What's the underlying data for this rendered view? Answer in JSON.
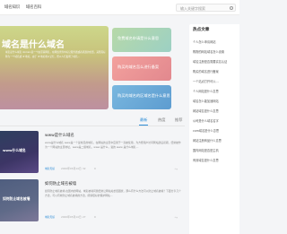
{
  "nav": {
    "items": [
      "域名知识",
      "域名百科"
    ]
  },
  "search": {
    "placeholder": "输入关键字搜索"
  },
  "hero": {
    "title": "域名是什么域名",
    "description": "域名是什么域名 domain是一个由互联网名，在网络世界中标记服务器或者机器的位置，其所需标称为一个域名或 IP 地址，由于 IP 地址难以记忆，所以人们发明了域名…"
  },
  "side_cards": [
    "免费域名申请是什么意思",
    "购买的域名怎么进行备案",
    "购买的域名的区域名是什么意思"
  ],
  "tabs": [
    "最新",
    "热度",
    "推荐"
  ],
  "articles": [
    {
      "thumb_text": "www什么域名",
      "title": "www是什么域名",
      "excerpt": "www是什么域名 www是一个最常见的域名，在网站的主页中应用于一直被使用，为方便用户访问网站建设初期，经常被作为一个网站的主页地址，www是二级域名，www 是什么，说的 www 是什么域名…",
      "category": "域名知识",
      "date": "2020年05月14日",
      "views": "32",
      "likes": "0"
    },
    {
      "thumb_text": "如何防止域名被墙",
      "title": "如何防止域名被墙",
      "excerpt": "如何防止域名被墙 在国内的网站，域名被墙问题经常让网站站长很困扰，那么有什么方法可以防止域名被墙？下面分享几个方法，可以有效防止域名被墙的方法，能够很好的保护网站…",
      "category": "域名知识",
      "date": "2020年05月14日",
      "views": "27",
      "likes": "0"
    }
  ],
  "sidebar": {
    "title": "热点文章",
    "items": [
      "个人怎么申请网站",
      "购物的网站域名怎么设置",
      "域名注册是否需要实名认证",
      "购买的域名进行备案",
      "一个站点打开可以…",
      "个人网站是什么意思",
      "域名怎么能加速网站",
      "网站域名是什么意思",
      "公司是什么域名名字",
      "com域名是什么意思",
      "网站注册商品什么意思",
      "国内网站是否是主机",
      "有效域名是什么意思"
    ]
  }
}
